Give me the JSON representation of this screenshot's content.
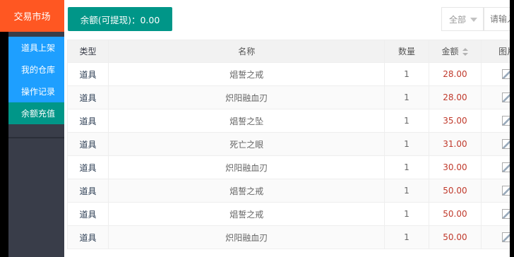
{
  "sidebar": {
    "title": "交易市场",
    "items": [
      {
        "label": "道具上架",
        "active": false
      },
      {
        "label": "我的仓库",
        "active": false
      },
      {
        "label": "操作记录",
        "active": false
      },
      {
        "label": "余额充值",
        "active": true
      }
    ]
  },
  "topbar": {
    "balance_label": "余额(可提现)：0.00",
    "filter_selected": "全部",
    "search_placeholder": "请输入"
  },
  "table": {
    "headers": [
      "类型",
      "名称",
      "数量",
      "金额",
      "图片"
    ],
    "rows": [
      {
        "type": "道具",
        "name": "焻誓之戒",
        "qty": "1",
        "amount": "28.00"
      },
      {
        "type": "道具",
        "name": "炽阳融血刃",
        "qty": "1",
        "amount": "28.00"
      },
      {
        "type": "道具",
        "name": "焻誓之坠",
        "qty": "1",
        "amount": "35.00"
      },
      {
        "type": "道具",
        "name": "死亡之眼",
        "qty": "1",
        "amount": "31.00"
      },
      {
        "type": "道具",
        "name": "炽阳融血刃",
        "qty": "1",
        "amount": "30.00"
      },
      {
        "type": "道具",
        "name": "焻誓之戒",
        "qty": "1",
        "amount": "50.00"
      },
      {
        "type": "道具",
        "name": "焻誓之戒",
        "qty": "1",
        "amount": "50.00"
      },
      {
        "type": "道具",
        "name": "炽阳融血刃",
        "qty": "1",
        "amount": "50.00"
      }
    ]
  },
  "colors": {
    "sidebar_top": "#ff5722",
    "menu_blue": "#1e9fff",
    "menu_active": "#009688",
    "amount_red": "#c0392b"
  }
}
